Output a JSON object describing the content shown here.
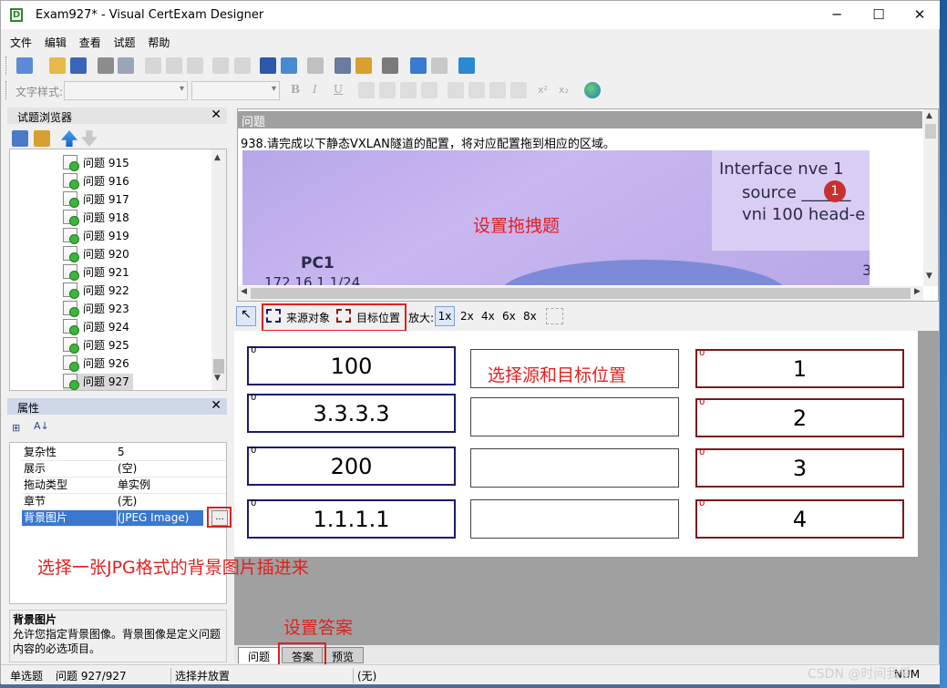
{
  "window": {
    "title": "Exam927* - Visual CertExam Designer"
  },
  "menu": [
    "文件",
    "编辑",
    "查看",
    "试题",
    "帮助"
  ],
  "format_toolbar": {
    "style_label": "文字样式:"
  },
  "browser": {
    "title": "试题浏览器",
    "items": [
      "问题 915",
      "问题 916",
      "问题 917",
      "问题 918",
      "问题 919",
      "问题 920",
      "问题 921",
      "问题 922",
      "问题 923",
      "问题 924",
      "问题 925",
      "问题 926",
      "问题 927"
    ],
    "selected": "问题 927"
  },
  "properties": {
    "title": "属性",
    "rows": [
      {
        "key": "复杂性",
        "value": "5"
      },
      {
        "key": "展示",
        "value": "(空)"
      },
      {
        "key": "拖动类型",
        "value": "单实例"
      },
      {
        "key": "章节",
        "value": "(无)"
      },
      {
        "key": "背景图片",
        "value": "(JPEG Image)"
      }
    ],
    "ellipsis": "...",
    "desc_title": "背景图片",
    "desc_text": "允许您指定背景图像。背景图像是定义问题内容的必选项目。"
  },
  "question": {
    "header": "问题",
    "text": "938.请完成以下静态VXLAN隧道的配置，将对应配置拖到相应的区域。",
    "image_text": {
      "l1": "Interface nve 1",
      "l2": "source ______",
      "badge": "1",
      "l3": "vni 100 head-e",
      "pc": "PC1",
      "ip": "172.16.1.1/24",
      "three": "3"
    }
  },
  "drag_toolbar": {
    "source": "来源对象",
    "target": "目标位置",
    "zoom_label": "放大:",
    "zooms": [
      "1x",
      "2x",
      "4x",
      "6x",
      "8x"
    ],
    "zoom_selected": "1x"
  },
  "sources": [
    "100",
    "3.3.3.3",
    "200",
    "1.1.1.1"
  ],
  "targets": [
    "1",
    "2",
    "3",
    "4"
  ],
  "box_index": "0",
  "tabs": [
    "问题",
    "答案",
    "预览"
  ],
  "active_tab": "答案",
  "status": {
    "mode": "单选题",
    "q": "问题 927/927",
    "action": "选择并放置",
    "extra": "(无)",
    "num": "NUM"
  },
  "annotations": {
    "drag_type": "设置拖拽题",
    "select_src_tgt": "选择源和目标位置",
    "insert_bg": "选择一张JPG格式的背景图片插进来",
    "set_answer": "设置答案"
  },
  "watermark": "CSDN @时间我爱"
}
